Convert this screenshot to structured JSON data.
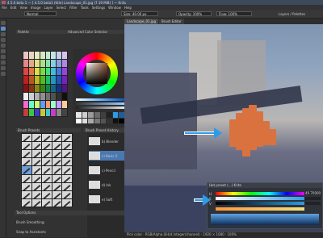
{
  "window": {
    "title": "4.5.0 beta 1 — [ 4.5.0 beta1 (title) Landscape_01.jpg (7.19 MiB) ] — Krita"
  },
  "menubar": {
    "items": [
      "File",
      "Edit",
      "View",
      "Image",
      "Layer",
      "Select",
      "Filter",
      "Tools",
      "Settings",
      "Window",
      "Help"
    ]
  },
  "tooloptions": {
    "blend_mode": "Normal",
    "size_label": "Size: 40.00 px",
    "opacity_label": "Opacity: 100%",
    "flow_label": "Flow: 100%",
    "extra_label": "Wrap Around Mode",
    "right_label": "Layers / Palettes"
  },
  "dockers": {
    "palette_title": "Palette",
    "advanced_color_title": "Advanced Color Selector",
    "brush_presets_title": "Brush Presets",
    "brush_history_title": "Brush Preset History",
    "lower_title": "Tool Options",
    "brush_smoothing": "Brush Smoothing:",
    "snap_assistants": "Snap to Assistants"
  },
  "canvas_tabs": [
    "Landscape_01.jpg",
    "Brush Editor"
  ],
  "popup": {
    "title": "Hot preset (...)  Krita",
    "rows": [
      {
        "label": "H",
        "value": "49.70000"
      },
      {
        "label": "S",
        "value": ""
      },
      {
        "label": "V",
        "value": ""
      },
      {
        "label": "",
        "value": ""
      }
    ]
  },
  "status": {
    "text": "Pick color  ·  RGB/Alpha (8-bit integer/channel)  ·  1920 × 1080  ·  100%"
  },
  "colors": {
    "accent": "#2c9ce8",
    "stroke": "#d9723e"
  },
  "palette_colors": [
    "#e9c4c4",
    "#e9d6c4",
    "#e9e9c4",
    "#d6e9c4",
    "#c4e9cf",
    "#c4e2e9",
    "#c4cfe9",
    "#d6c4e9",
    "#e08888",
    "#e0aa88",
    "#e0e088",
    "#aae088",
    "#88e0a8",
    "#88cfe0",
    "#88a0e0",
    "#b088e0",
    "#d44",
    "#d74",
    "#dd4",
    "#7d4",
    "#4d7",
    "#4bd",
    "#47d",
    "#94d",
    "#b22",
    "#b52",
    "#bb2",
    "#5b2",
    "#2b6",
    "#29b",
    "#25b",
    "#72b",
    "#811",
    "#831",
    "#881",
    "#381",
    "#184",
    "#168",
    "#138",
    "#518",
    "#f0f0f0",
    "#d0d0d0",
    "#b0b0b0",
    "#909090",
    "#707070",
    "#505050",
    "#303030",
    "#101010",
    "#ff66cc",
    "#66ffcc",
    "#ccff66",
    "#6699ff",
    "#ff9966",
    "#99ffcc",
    "#cc99ff",
    "#ffcc99",
    "#c83c3c",
    "#3cc83c",
    "#3c3cc8",
    "#c8c83c",
    "#3cc8c8",
    "#c83cc8",
    "#888",
    "#444"
  ],
  "history_items": [
    "b) Blender",
    "c) Basic 5",
    "c) Pencil",
    "d) Ink",
    "e) Soft"
  ],
  "icons": [
    "arrow-icon",
    "brush-icon",
    "eraser-icon",
    "fill-icon",
    "eyedropper-icon",
    "selection-icon",
    "text-icon",
    "transform-icon",
    "zoom-icon",
    "hand-icon"
  ]
}
